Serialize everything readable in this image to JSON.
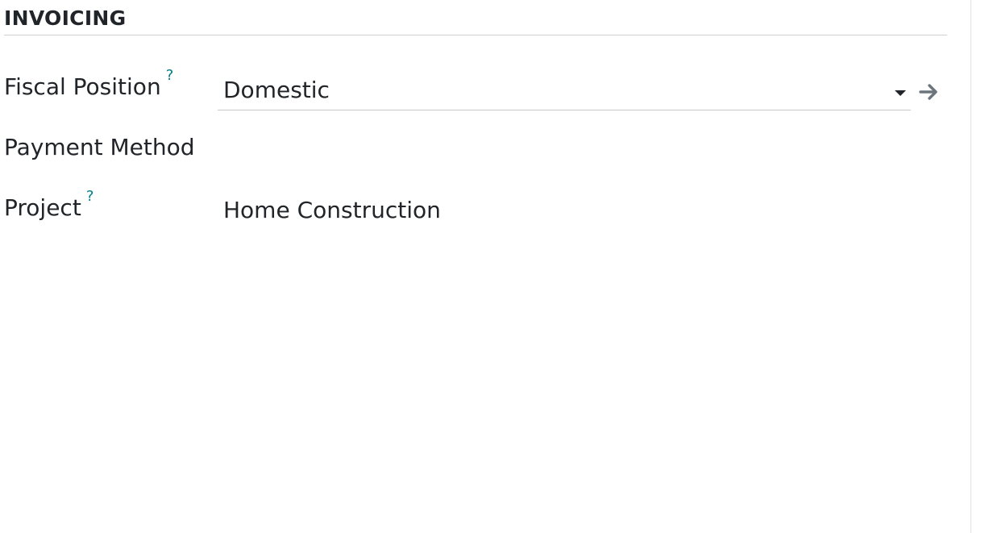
{
  "section": {
    "title": "INVOICING"
  },
  "fields": {
    "fiscal_position": {
      "label": "Fiscal Position",
      "help": "?",
      "value": "Domestic"
    },
    "payment_method": {
      "label": "Payment Method",
      "value": ""
    },
    "project": {
      "label": "Project",
      "help": "?",
      "value": "Home Construction"
    }
  },
  "icons": {
    "help": "question-mark",
    "dropdown": "caret-down",
    "open_record": "arrow-right"
  },
  "colors": {
    "text": "#212529",
    "help_accent": "#017e84",
    "arrow": "#6c757d",
    "rule": "#cfd2d5"
  }
}
